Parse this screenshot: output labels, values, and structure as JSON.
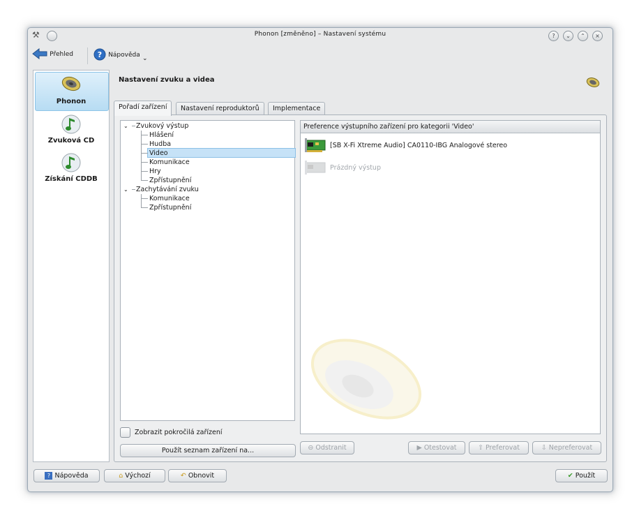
{
  "window": {
    "title": "Phonon [změněno] – Nastavení systému"
  },
  "toolbar": {
    "back_label": "Přehled",
    "help_label": "Nápověda"
  },
  "sidebar": {
    "items": [
      {
        "label": "Phonon",
        "icon": "speaker-icon"
      },
      {
        "label": "Zvuková CD",
        "icon": "music-note-icon"
      },
      {
        "label": "Získání CDDB",
        "icon": "music-note-icon"
      }
    ]
  },
  "page": {
    "title": "Nastavení zvuku a videa"
  },
  "tabs": [
    {
      "label": "Pořadí zařízení"
    },
    {
      "label": "Nastavení reproduktorů"
    },
    {
      "label": "Implementace"
    }
  ],
  "tree": {
    "groups": [
      {
        "label": "Zvukový výstup",
        "children": [
          "Hlášení",
          "Hudba",
          "Video",
          "Komunikace",
          "Hry",
          "Zpřístupnění"
        ]
      },
      {
        "label": "Zachytávání zvuku",
        "children": [
          "Komunikace",
          "Zpřístupnění"
        ]
      }
    ],
    "selected": "Video"
  },
  "preference": {
    "header": "Preference výstupního zařízení pro kategorii 'Video'",
    "devices": [
      {
        "label": "[SB X-Fi Xtreme Audio] CA0110-IBG Analogové stereo",
        "enabled": true
      },
      {
        "label": "Prázdný výstup",
        "enabled": false
      }
    ]
  },
  "options": {
    "advanced_checkbox": "Zobrazit pokročilá zařízení",
    "apply_list_button": "Použít seznam zařízení na..."
  },
  "device_buttons": {
    "remove": "Odstranit",
    "test": "Otestovat",
    "prefer": "Preferovat",
    "defer": "Nepreferovat"
  },
  "footer": {
    "help": "Nápověda",
    "defaults": "Výchozí",
    "reset": "Obnovit",
    "apply": "Použít"
  },
  "colors": {
    "selection": "#c6e2f7",
    "window_bg": "#e8e9ea",
    "accent_green": "#3a9a2a"
  }
}
